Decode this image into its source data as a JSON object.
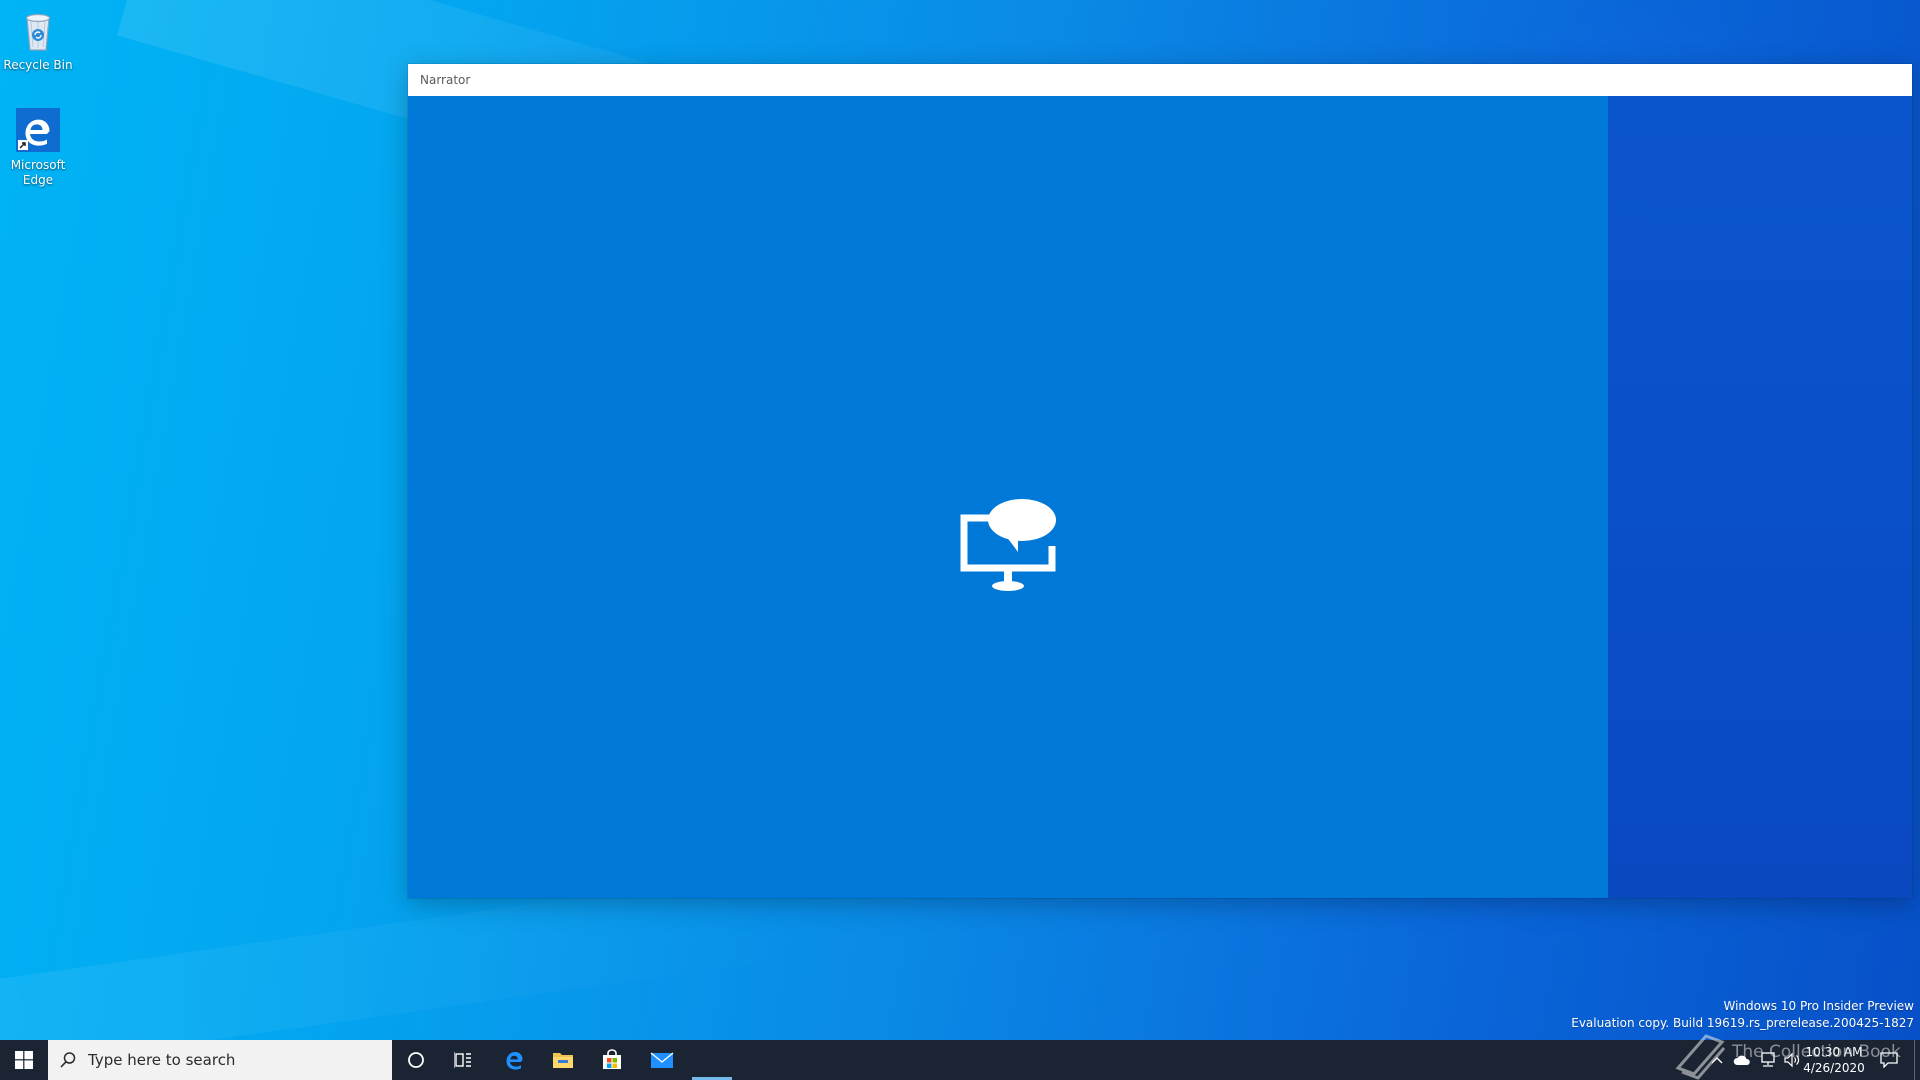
{
  "desktop": {
    "icons": [
      {
        "label": "Recycle Bin",
        "icon": "recycle-bin-icon"
      },
      {
        "label": "Microsoft Edge",
        "icon": "edge-icon"
      }
    ]
  },
  "narrator": {
    "title": "Narrator",
    "splash_icon": "narrator-icon",
    "splash_color": "#0078d7"
  },
  "watermark": {
    "line1": "Windows 10 Pro Insider Preview",
    "line2": "Evaluation copy. Build 19619.rs_prerelease.200425-1827"
  },
  "taskbar": {
    "search_placeholder": "Type here to search",
    "apps": [
      {
        "name": "Cortana",
        "icon": "cortana-icon"
      },
      {
        "name": "Task View",
        "icon": "task-view-icon"
      },
      {
        "name": "Microsoft Edge",
        "icon": "edge-icon"
      },
      {
        "name": "File Explorer",
        "icon": "folder-icon"
      },
      {
        "name": "Microsoft Store",
        "icon": "store-icon"
      },
      {
        "name": "Mail",
        "icon": "mail-icon"
      }
    ],
    "clock": {
      "time": "10:30 AM",
      "date": "4/26/2020"
    },
    "overlay_text": "The Collection Book"
  },
  "colors": {
    "taskbar": "#1a2433",
    "accent": "#0078d7"
  }
}
